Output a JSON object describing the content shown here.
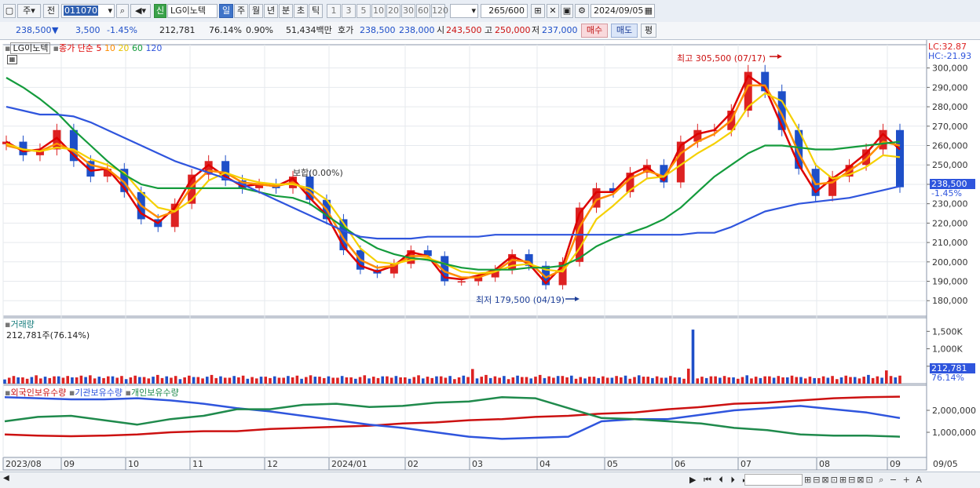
{
  "toolbar": {
    "chk": "주",
    "prev": "전",
    "code": "011070",
    "shin": "신",
    "name": "LG이노텍",
    "periods": [
      "일",
      "주",
      "월",
      "년",
      "분",
      "초",
      "틱"
    ],
    "minutes": [
      "1",
      "3",
      "5",
      "10",
      "20",
      "30",
      "60",
      "120"
    ],
    "count": "265",
    "count_total": "/600",
    "date": "2024/09/05"
  },
  "quote": {
    "price": "238,500",
    "arrow": "▼",
    "change": "3,500",
    "pct": "-1.45%",
    "volume": "212,781",
    "vol_ratio": "76.14%",
    "turnover": "0.90%",
    "amount": "51,434백만",
    "hoga_label": "호가",
    "ask": "238,500",
    "bid": "238,000",
    "open_label": "시",
    "open": "243,500",
    "high_label": "고",
    "high": "250,000",
    "low_label": "저",
    "low": "237,000",
    "buy": "매수",
    "sell": "매도",
    "eval": "평"
  },
  "legend": {
    "name": "LG이노텍",
    "series": "종가 단순",
    "ma": [
      "5",
      "10",
      "20",
      "60",
      "120"
    ],
    "ma_colors": [
      "#dd0000",
      "#ff8c00",
      "#f5d000",
      "#149b3c",
      "#2f55dd"
    ]
  },
  "annotations": {
    "high": "최고 305,500 (07/17)",
    "low": "최저 179,500 (04/19)",
    "mid": "보합(0.00%)",
    "lc": "LC:32.87",
    "hc": "HC:-21.93",
    "price_tag": "238,500",
    "price_tag_pct": "-1.45%",
    "vol_tag": "212,781",
    "vol_tag_pct": "76.14%"
  },
  "volume_panel": {
    "title": "거래량",
    "value": "212,781주(76.14%)",
    "ticks": [
      "1,500K",
      "1,000K",
      "500,000"
    ]
  },
  "holding_panel": {
    "titles": [
      "외국인보유수량",
      "기관보유수량",
      "개인보유수량"
    ],
    "colors": [
      "#cc1111",
      "#2f55dd",
      "#1f8a4c"
    ],
    "ticks": [
      "2,000,000",
      "1,000,000"
    ]
  },
  "colors": {
    "up": "#dd2222",
    "down": "#1e4fc8",
    "accent": "#3f74c9"
  },
  "chart_data": {
    "type": "candlestick",
    "x_labels": [
      "2023/08",
      "09",
      "10",
      "11",
      "12",
      "2024/01",
      "02",
      "03",
      "04",
      "05",
      "06",
      "07",
      "08",
      "09",
      "09/05"
    ],
    "ylim": [
      172000,
      312000
    ],
    "y_ticks": [
      180000,
      190000,
      200000,
      210000,
      220000,
      230000,
      240000,
      250000,
      260000,
      270000,
      280000,
      290000,
      300000
    ],
    "close_approx": [
      262000,
      255000,
      258000,
      268000,
      252000,
      244000,
      248000,
      236000,
      222000,
      218000,
      230000,
      245000,
      252000,
      242000,
      238000,
      240000,
      238000,
      244000,
      232000,
      222000,
      206000,
      196000,
      194000,
      199000,
      206000,
      203000,
      190000,
      190000,
      192000,
      196000,
      204000,
      198000,
      188000,
      200000,
      228000,
      238000,
      236000,
      246000,
      250000,
      241000,
      262000,
      268000,
      268000,
      278000,
      298000,
      288000,
      268000,
      248000,
      234000,
      244000,
      250000,
      258000,
      268000,
      238500
    ],
    "series": [
      {
        "name": "5",
        "values": [
          262000,
          257000,
          258000,
          264000,
          255000,
          247000,
          248000,
          238000,
          225000,
          220000,
          228000,
          243000,
          250000,
          244000,
          239000,
          240000,
          239000,
          243000,
          233000,
          224000,
          208000,
          198000,
          195000,
          198000,
          205000,
          203000,
          192000,
          191000,
          193000,
          196000,
          203000,
          199000,
          189000,
          198000,
          225000,
          236000,
          236000,
          245000,
          249000,
          242000,
          260000,
          266000,
          268000,
          277000,
          296000,
          290000,
          270000,
          250000,
          236000,
          243000,
          249000,
          256000,
          266000,
          258000
        ]
      },
      {
        "name": "10",
        "values": [
          260000,
          258000,
          257000,
          261000,
          257000,
          250000,
          248000,
          241000,
          229000,
          223000,
          226000,
          239000,
          247000,
          246000,
          241000,
          240000,
          239000,
          241000,
          236000,
          227000,
          212000,
          201000,
          197000,
          198000,
          203000,
          203000,
          195000,
          192000,
          192000,
          195000,
          201000,
          200000,
          192000,
          196000,
          218000,
          232000,
          235000,
          243000,
          247000,
          244000,
          256000,
          262000,
          266000,
          273000,
          291000,
          291000,
          276000,
          256000,
          240000,
          241000,
          247000,
          253000,
          262000,
          260000
        ]
      },
      {
        "name": "20",
        "values": [
          261000,
          258000,
          257000,
          259000,
          258000,
          253000,
          250000,
          246000,
          236000,
          228000,
          226000,
          232000,
          242000,
          246000,
          243000,
          241000,
          240000,
          240000,
          238000,
          232000,
          220000,
          207000,
          200000,
          199000,
          201000,
          202000,
          199000,
          195000,
          194000,
          195000,
          198000,
          199000,
          196000,
          195000,
          207000,
          222000,
          229000,
          237000,
          243000,
          244000,
          250000,
          256000,
          261000,
          267000,
          280000,
          287000,
          283000,
          268000,
          250000,
          243000,
          245000,
          249000,
          255000,
          254000
        ]
      },
      {
        "name": "60",
        "values": [
          295000,
          290000,
          284000,
          277000,
          268000,
          260000,
          252000,
          245000,
          240000,
          238000,
          238000,
          238000,
          238000,
          238000,
          238000,
          236000,
          234000,
          233000,
          230000,
          224000,
          218000,
          212000,
          207000,
          204000,
          202000,
          201000,
          199000,
          197000,
          196000,
          196000,
          196000,
          197000,
          197000,
          198000,
          202000,
          208000,
          212000,
          215000,
          218000,
          222000,
          228000,
          236000,
          244000,
          250000,
          256000,
          260000,
          260000,
          259000,
          258000,
          258000,
          259000,
          260000,
          261000,
          262000
        ]
      },
      {
        "name": "120",
        "values": [
          280000,
          278000,
          276000,
          276000,
          275000,
          272000,
          268000,
          264000,
          260000,
          256000,
          252000,
          249000,
          246000,
          243000,
          240000,
          236000,
          232000,
          228000,
          224000,
          220000,
          216000,
          213000,
          212000,
          212000,
          212000,
          213000,
          213000,
          213000,
          213000,
          214000,
          214000,
          214000,
          214000,
          214000,
          214000,
          214000,
          214000,
          214000,
          214000,
          214000,
          214000,
          215000,
          215000,
          218000,
          222000,
          226000,
          228000,
          230000,
          231000,
          232000,
          233000,
          235000,
          237000,
          239000
        ]
      }
    ],
    "holdings": {
      "foreign": [
        0.9,
        0.85,
        0.82,
        0.85,
        0.9,
        1.0,
        1.05,
        1.05,
        1.15,
        1.2,
        1.25,
        1.3,
        1.4,
        1.45,
        1.55,
        1.6,
        1.7,
        1.75,
        1.85,
        1.9,
        2.05,
        2.15,
        2.3,
        2.35,
        2.45,
        2.55,
        2.6,
        2.62
      ],
      "institution": [
        2.6,
        2.55,
        2.5,
        2.5,
        2.55,
        2.45,
        2.3,
        2.1,
        1.95,
        1.75,
        1.55,
        1.35,
        1.2,
        1.0,
        0.8,
        0.7,
        0.75,
        0.8,
        1.5,
        1.6,
        1.6,
        1.8,
        2.0,
        2.1,
        2.2,
        2.05,
        1.9,
        1.65
      ],
      "individual": [
        1.5,
        1.7,
        1.75,
        1.55,
        1.35,
        1.6,
        1.75,
        2.05,
        2.05,
        2.25,
        2.3,
        2.15,
        2.2,
        2.35,
        2.4,
        2.6,
        2.55,
        2.1,
        1.65,
        1.6,
        1.5,
        1.4,
        1.2,
        1.1,
        0.9,
        0.85,
        0.85,
        0.8
      ]
    }
  }
}
